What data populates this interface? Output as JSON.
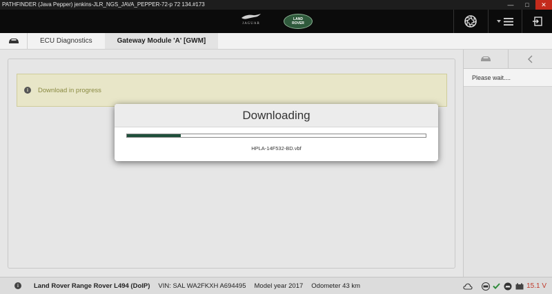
{
  "window": {
    "title": "PATHFINDER (Java Pepper) jenkins-JLR_NGS_JAVA_PEPPER-72-p 72 134.#173"
  },
  "header": {
    "jaguar_word": "JAGUAR",
    "landrover_line1": "LAND",
    "landrover_line2": "ROVER"
  },
  "breadcrumb": {
    "items": [
      {
        "label": "ECU Diagnostics"
      },
      {
        "label": "Gateway Module 'A' [GWM]"
      }
    ]
  },
  "alert": {
    "message": "Download in progress"
  },
  "side_panel": {
    "message": "Please wait...."
  },
  "modal": {
    "title": "Downloading",
    "progress": 0.18,
    "filename": "HPLA-14F532-BD.vbf"
  },
  "statusbar": {
    "vehicle": "Land Rover Range Rover L494 (DoIP)",
    "vin": "VIN: SAL WA2FKXH A694495",
    "model_year": "Model year 2017",
    "odometer": "Odometer 43 km",
    "voltage": "15.1 V"
  },
  "colors": {
    "progress_fill": "#1f4f3b",
    "voltage": "#c0392b",
    "check": "#2e8b3a"
  },
  "icons": {
    "info": "info-icon",
    "camera": "camera-shutter-icon",
    "menu": "menu-icon",
    "logout": "logout-icon",
    "car": "car-icon",
    "back": "chevron-left-icon"
  }
}
